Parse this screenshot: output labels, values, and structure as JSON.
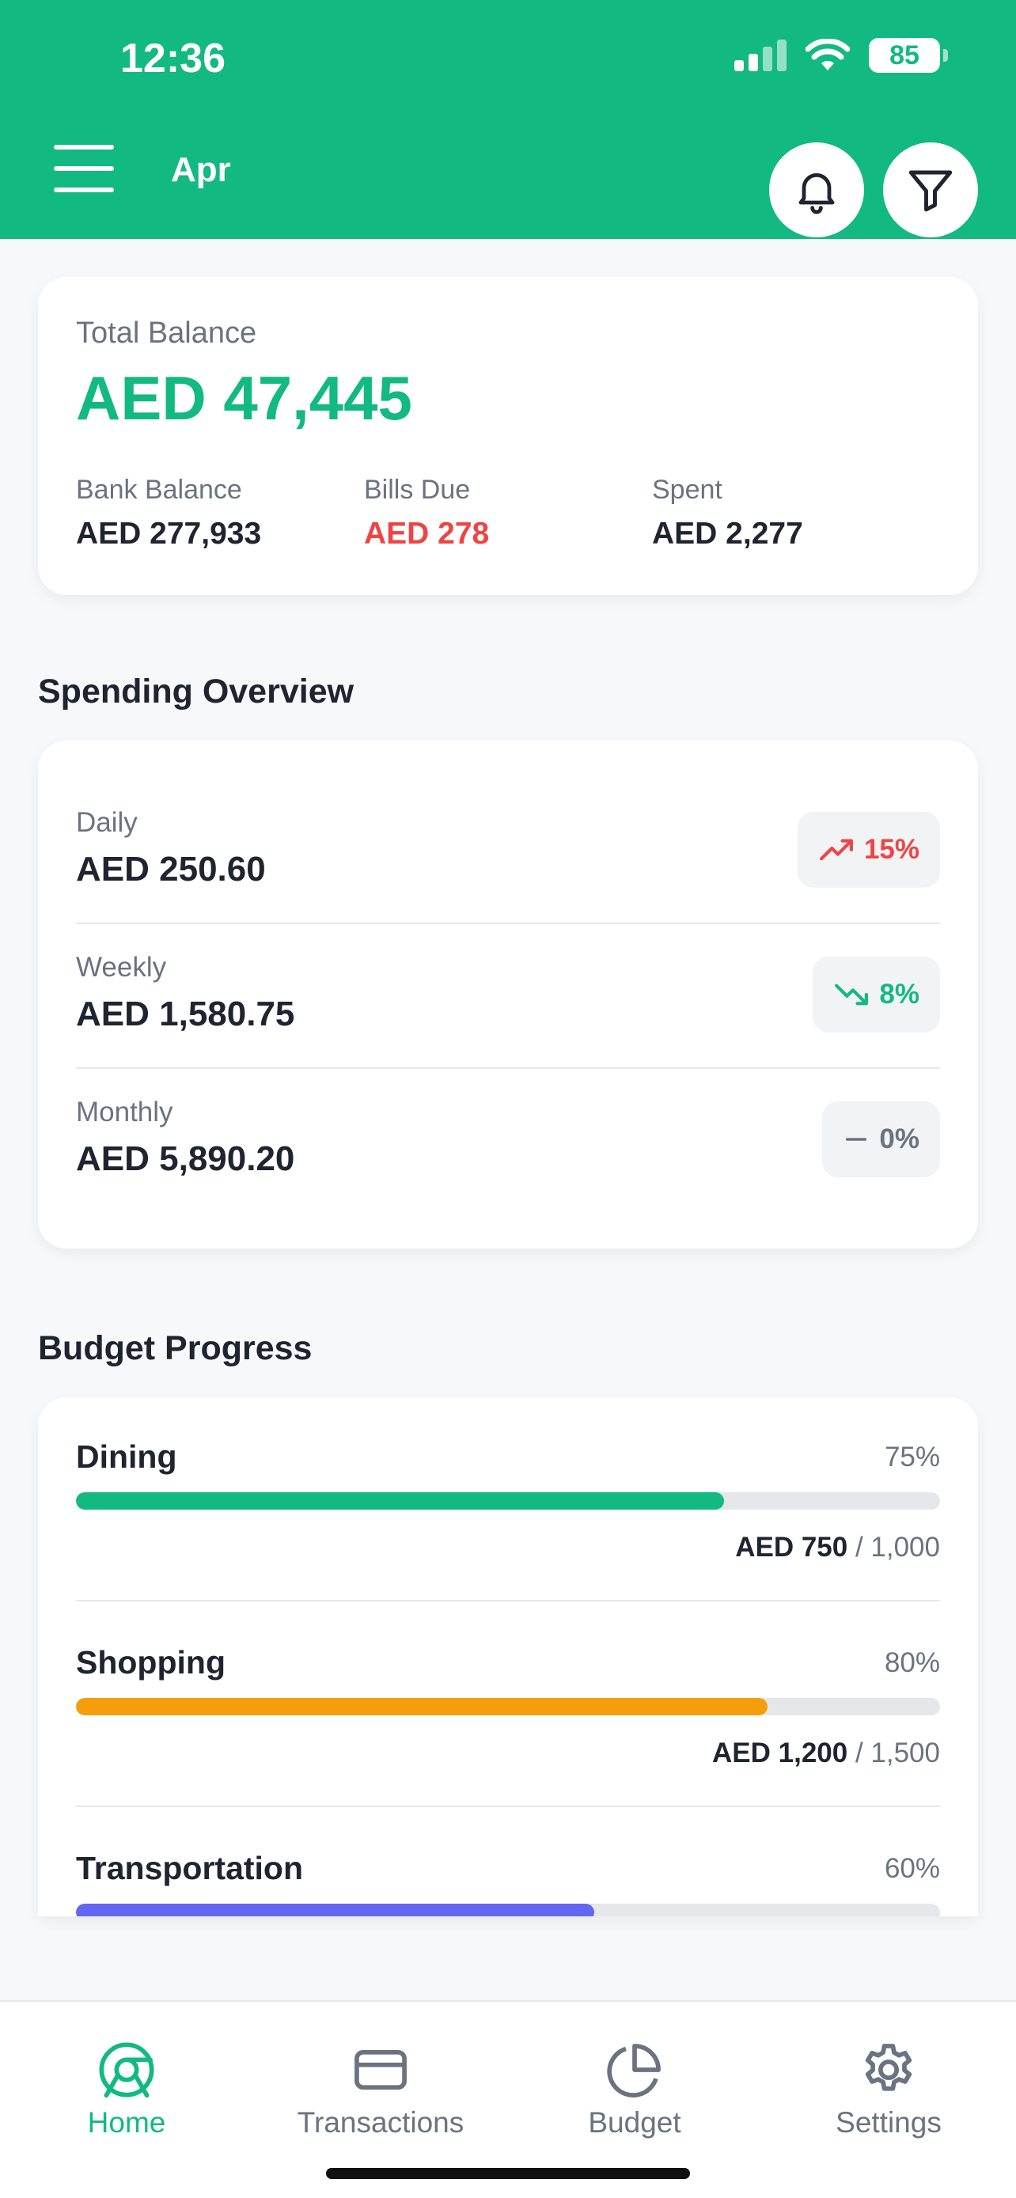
{
  "status_bar": {
    "time": "12:36",
    "battery": "85"
  },
  "header": {
    "month": "Apr"
  },
  "balance": {
    "label": "Total Balance",
    "total": "AED 47,445",
    "bank_label": "Bank Balance",
    "bank_value": "AED 277,933",
    "bills_label": "Bills Due",
    "bills_value": "AED 278",
    "spent_label": "Spent",
    "spent_value": "AED 2,277"
  },
  "overview": {
    "title": "Spending Overview",
    "rows": [
      {
        "label": "Daily",
        "value": "AED 250.60",
        "trend": "15%",
        "trend_icon": "trend-up-icon",
        "trend_color": "#ef4444"
      },
      {
        "label": "Weekly",
        "value": "AED 1,580.75",
        "trend": "8%",
        "trend_icon": "trend-down-icon",
        "trend_color": "#12b981"
      },
      {
        "label": "Monthly",
        "value": "AED 5,890.20",
        "trend": "0%",
        "trend_icon": "minus-icon",
        "trend_color": "#6b7280"
      }
    ]
  },
  "budget": {
    "title": "Budget Progress",
    "items": [
      {
        "name": "Dining",
        "percent": "75%",
        "progress": 0.75,
        "spent": "AED 750",
        "limit": " / 1,000",
        "color": "#12b981"
      },
      {
        "name": "Shopping",
        "percent": "80%",
        "progress": 0.8,
        "spent": "AED 1,200",
        "limit": " / 1,500",
        "color": "#f59e0b"
      },
      {
        "name": "Transportation",
        "percent": "60%",
        "progress": 0.6,
        "color": "#6366f1"
      }
    ]
  },
  "tabs": [
    {
      "label": "Home",
      "icon": "home-chart-icon",
      "active": true
    },
    {
      "label": "Transactions",
      "icon": "card-icon"
    },
    {
      "label": "Budget",
      "icon": "pie-icon"
    },
    {
      "label": "Settings",
      "icon": "gear-icon"
    }
  ],
  "colors": {
    "accent": "#12b981",
    "danger": "#ef4444",
    "warning": "#f59e0b",
    "indigo": "#6366f1"
  }
}
